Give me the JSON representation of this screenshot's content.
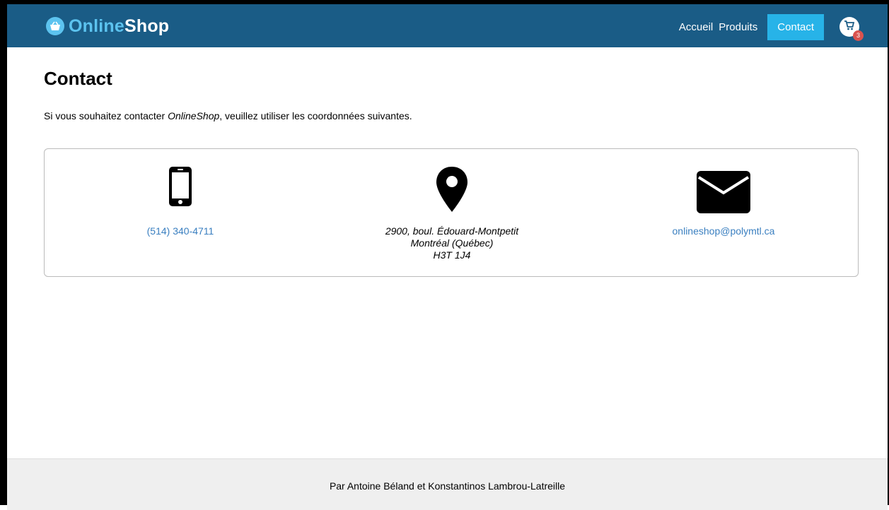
{
  "brand": {
    "name_part1": "Online",
    "name_part2": "Shop",
    "icon": "shopping-basket-icon"
  },
  "nav": {
    "links": [
      {
        "label": "Accueil",
        "active": false
      },
      {
        "label": "Produits",
        "active": false
      },
      {
        "label": "Contact",
        "active": true
      }
    ],
    "cart": {
      "icon": "cart-icon",
      "count": "3"
    }
  },
  "page": {
    "title": "Contact",
    "intro_before": "Si vous souhaitez contacter ",
    "intro_brand": "OnlineShop",
    "intro_after": ", veuillez utiliser les coordonnées suivantes."
  },
  "contact": {
    "phone": {
      "icon": "phone-icon",
      "value": "(514) 340-4711"
    },
    "address": {
      "icon": "map-marker-icon",
      "line1": "2900, boul. Édouard-Montpetit",
      "line2": "Montréal (Québec)",
      "line3": "H3T 1J4"
    },
    "email": {
      "icon": "envelope-icon",
      "value": "onlineshop@polymtl.ca"
    }
  },
  "footer": {
    "text": "Par Antoine Béland et Konstantinos Lambrou-Latreille"
  },
  "colors": {
    "navbar": "#1a5c86",
    "accent": "#27b3e8",
    "link": "#3a7fc0",
    "badge": "#d9534f"
  }
}
